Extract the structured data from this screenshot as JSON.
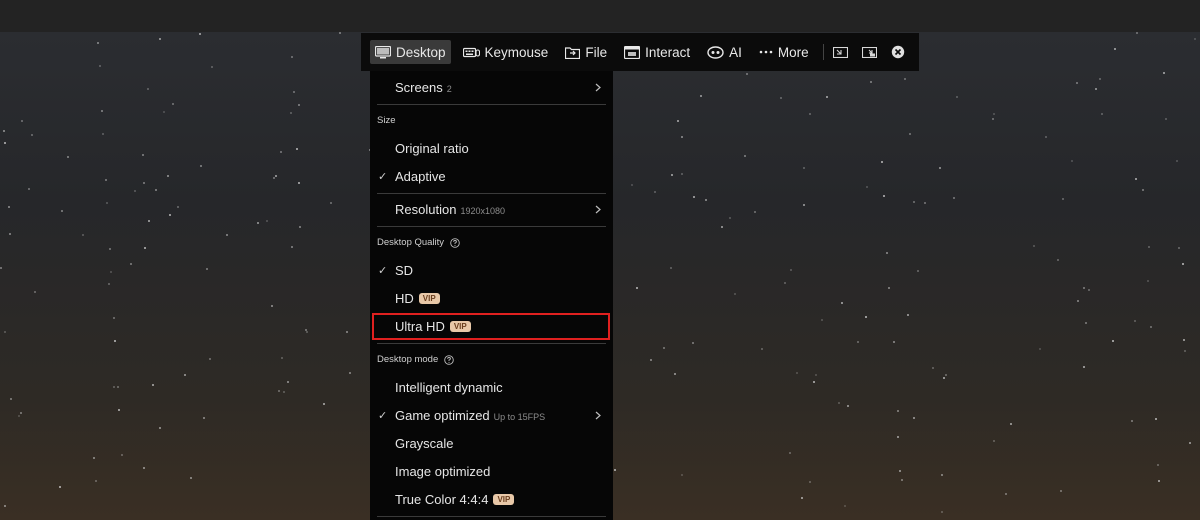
{
  "toolbar": {
    "items": [
      {
        "label": "Desktop",
        "icon": "monitor-icon",
        "active": true
      },
      {
        "label": "Keymouse",
        "icon": "keyboard-icon"
      },
      {
        "label": "File",
        "icon": "file-transfer-icon"
      },
      {
        "label": "Interact",
        "icon": "chat-window-icon"
      },
      {
        "label": "AI",
        "icon": "ai-robot-icon"
      },
      {
        "label": "More",
        "icon": "more-dots-icon"
      }
    ],
    "extra_icons": [
      "minimize-window-icon",
      "picture-in-picture-icon",
      "close-circle-icon"
    ]
  },
  "menu": {
    "screens": {
      "label": "Screens",
      "sub": "2"
    },
    "size_header": "Size",
    "original_ratio": "Original ratio",
    "adaptive": "Adaptive",
    "resolution": {
      "label": "Resolution",
      "sub": "1920x1080"
    },
    "quality_header": "Desktop Quality",
    "sd": "SD",
    "hd": "HD",
    "ultra_hd": "Ultra HD",
    "vip": "VIP",
    "mode_header": "Desktop mode",
    "intelligent": "Intelligent dynamic",
    "game": {
      "label": "Game optimized",
      "sub": "Up to 15FPS"
    },
    "grayscale": "Grayscale",
    "image_optimized": "Image optimized",
    "true_color": "True Color 4:4:4",
    "checked": [
      "adaptive",
      "sd",
      "game"
    ]
  },
  "colors": {
    "highlight": "#e0201f",
    "vip_bg": "#e8c8a8",
    "vip_text": "#6a3e1e"
  }
}
